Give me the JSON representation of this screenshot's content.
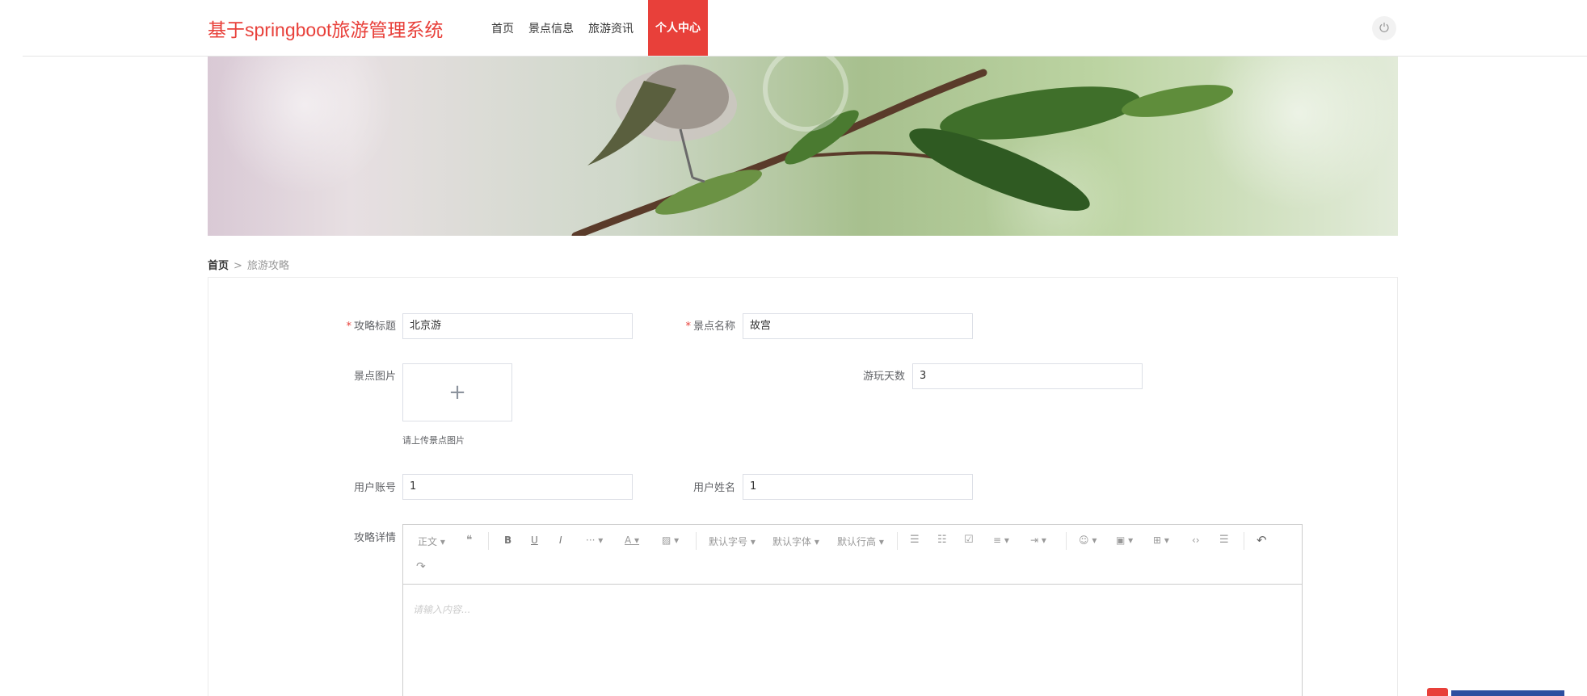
{
  "header": {
    "site_title": "基于springboot旅游管理系统",
    "nav": [
      {
        "label": "首页",
        "active": false
      },
      {
        "label": "景点信息",
        "active": false
      },
      {
        "label": "旅游资讯",
        "active": false
      },
      {
        "label": "个人中心",
        "active": true
      }
    ],
    "power_icon": "power-icon"
  },
  "breadcrumb": {
    "home": "首页",
    "separator": ">",
    "current": "旅游攻略"
  },
  "form": {
    "title_label": "攻略标题",
    "title_value": "北京游",
    "spot_name_label": "景点名称",
    "spot_name_value": "故宫",
    "spot_image_label": "景点图片",
    "upload_plus": "+",
    "upload_tip": "请上传景点图片",
    "days_label": "游玩天数",
    "days_value": "3",
    "account_label": "用户账号",
    "account_value": "1",
    "name_label": "用户姓名",
    "name_value": "1",
    "detail_label": "攻略详情",
    "required_mark": "*"
  },
  "editor": {
    "toolbar": {
      "paragraph": "正文 ▾",
      "quote": "❝",
      "bold": "B",
      "underline": "U",
      "italic": "I",
      "more": "··· ▾",
      "font_color": "A ▾",
      "bg_color": "▨ ▾",
      "font_size": "默认字号 ▾",
      "font_family": "默认字体 ▾",
      "line_height": "默认行高 ▾",
      "bullet_list": "☰",
      "numbered_list": "☷",
      "todo": "☑",
      "align": "≡ ▾",
      "indent": "⇥ ▾",
      "emoji": "☺ ▾",
      "image": "▣ ▾",
      "table": "⊞ ▾",
      "code": "‹›",
      "divider": "☰",
      "undo": "↶",
      "redo": "↷"
    },
    "placeholder": "请输入内容..."
  },
  "colors": {
    "brand": "#e8403a",
    "border": "#dcdfe6"
  }
}
